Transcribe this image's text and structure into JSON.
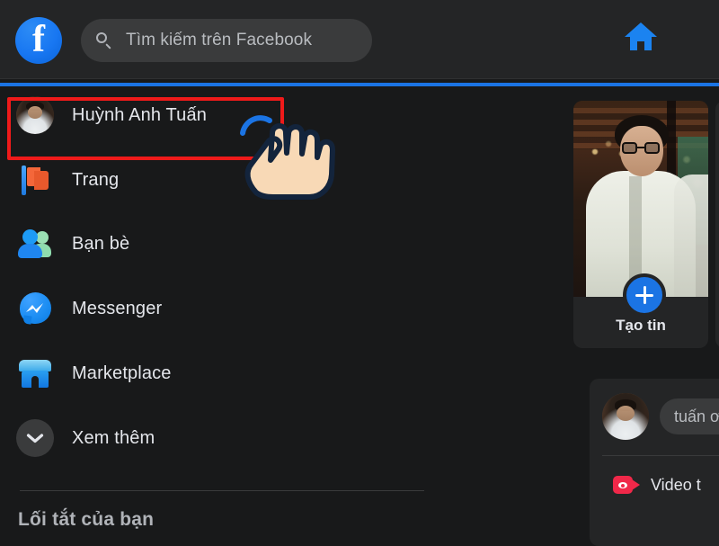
{
  "header": {
    "logo_icon": "facebook-logo-icon",
    "logo_glyph": "f",
    "search": {
      "icon": "search-icon",
      "placeholder": "Tìm kiếm trên Facebook",
      "value": ""
    },
    "home_tab": {
      "icon": "home-icon",
      "label": "Trang chủ",
      "active": true,
      "accent_color": "#1b74e4"
    }
  },
  "sidebar": {
    "items": [
      {
        "label": "Huỳnh Anh Tuấn",
        "icon": "profile-avatar-icon",
        "highlighted": true
      },
      {
        "label": "Trang",
        "icon": "pages-flag-icon"
      },
      {
        "label": "Bạn bè",
        "icon": "friends-icon"
      },
      {
        "label": "Messenger",
        "icon": "messenger-icon"
      },
      {
        "label": "Marketplace",
        "icon": "marketplace-icon"
      },
      {
        "label": "Xem thêm",
        "icon": "chevron-down-icon"
      }
    ],
    "shortcuts_title": "Lối tắt của bạn"
  },
  "annotation": {
    "highlight_color": "#ef1a1a",
    "cursor_icon": "pointing-hand-cursor-icon"
  },
  "stories": {
    "create_story": {
      "label": "Tạo tin",
      "plus_icon": "plus-icon"
    }
  },
  "composer": {
    "avatar_icon": "user-avatar-icon",
    "input_value": "tuấn ơ",
    "actions": [
      {
        "label": "Video t",
        "icon": "live-video-icon",
        "color": "#f02849"
      }
    ]
  },
  "colors": {
    "app_background": "#18191a",
    "header_background": "#242526",
    "card_background": "#242526",
    "input_background": "#3a3b3c",
    "primary_text": "#e4e6eb",
    "secondary_text": "#b0b3b8",
    "brand_blue": "#1877f2"
  }
}
